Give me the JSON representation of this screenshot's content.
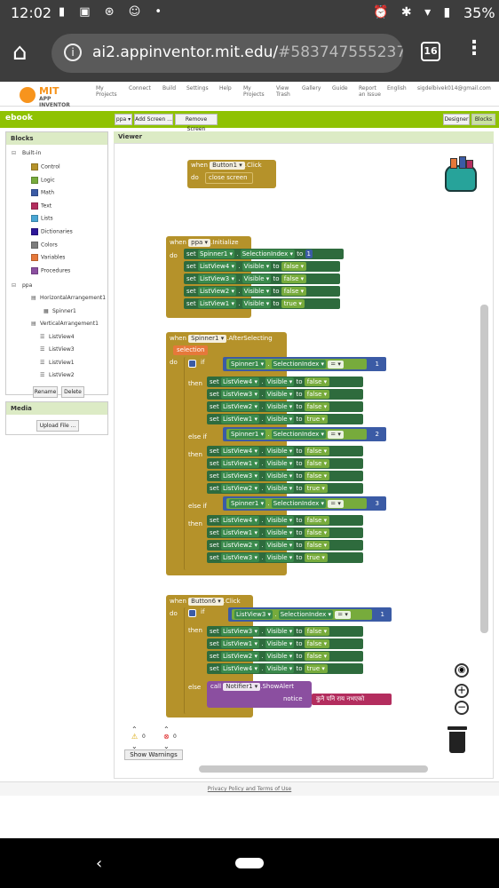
{
  "status": {
    "time": "12:02",
    "battery": "35%"
  },
  "browser": {
    "url_host": "ai2.appinventor.mit.edu/",
    "url_hash": "#583747555237",
    "tab_count": "16"
  },
  "appinv": {
    "logo_title": "MIT",
    "logo_sub": "APP INVENTOR",
    "nav": [
      "My Projects",
      "Connect",
      "Build",
      "Settings",
      "Help",
      "My Projects",
      "View Trash",
      "Gallery",
      "Guide",
      "Report an Issue",
      "English",
      "sigdelbivek014@gmail.com"
    ]
  },
  "screenbar": {
    "project": "ebook",
    "screen": "ppa ▾",
    "add": "Add Screen ...",
    "remove": "Remove Screen",
    "designer": "Designer",
    "blocks": "Blocks"
  },
  "blocks_panel": {
    "title": "Blocks",
    "builtin": "Built-in",
    "items": [
      {
        "label": "Control",
        "color": "#b5922a"
      },
      {
        "label": "Logic",
        "color": "#77ab3c"
      },
      {
        "label": "Math",
        "color": "#3b5ba5"
      },
      {
        "label": "Text",
        "color": "#b32d5e"
      },
      {
        "label": "Lists",
        "color": "#49a6d4"
      },
      {
        "label": "Dictionaries",
        "color": "#2d1799"
      },
      {
        "label": "Colors",
        "color": "#7d7d7d"
      },
      {
        "label": "Variables",
        "color": "#e6783a"
      },
      {
        "label": "Procedures",
        "color": "#8b4fa0"
      }
    ],
    "screen": "ppa",
    "components": [
      "HorizontalArrangement1",
      "Spinner1",
      "VerticalArrangement1",
      "ListView4",
      "ListView3",
      "ListView1",
      "ListView2"
    ],
    "rename": "Rename",
    "delete": "Delete"
  },
  "media": {
    "title": "Media",
    "upload": "Upload File ..."
  },
  "viewer": {
    "title": "Viewer"
  },
  "code": {
    "b1": {
      "when": "when",
      "comp": "Button1 ▾",
      "event": ".Click",
      "do": "do",
      "stmt": "close screen"
    },
    "init": {
      "when": "when",
      "comp": "ppa ▾",
      "event": ".Initialize",
      "do": "do",
      "sets": [
        {
          "comp": "Spinner1 ▾",
          "prop": "SelectionIndex ▾",
          "val": "1"
        },
        {
          "comp": "ListView4 ▾",
          "prop": "Visible ▾",
          "val": "false ▾"
        },
        {
          "comp": "ListView3 ▾",
          "prop": "Visible ▾",
          "val": "false ▾"
        },
        {
          "comp": "ListView2 ▾",
          "prop": "Visible ▾",
          "val": "false ▾"
        },
        {
          "comp": "ListView1 ▾",
          "prop": "Visible ▾",
          "val": "true ▾"
        }
      ]
    },
    "sel": {
      "when": "when",
      "comp": "Spinner1 ▾",
      "event": ".AfterSelecting",
      "param": "selection",
      "do": "do",
      "if": "if",
      "then": "then",
      "elseif": "else if",
      "conds": [
        {
          "comp": "Spinner1 ▾",
          "prop": "SelectionIndex ▾",
          "op": "= ▾",
          "num": "1"
        },
        {
          "comp": "Spinner1 ▾",
          "prop": "SelectionIndex ▾",
          "op": "= ▾",
          "num": "2"
        },
        {
          "comp": "Spinner1 ▾",
          "prop": "SelectionIndex ▾",
          "op": "= ▾",
          "num": "3"
        }
      ],
      "groups": [
        [
          {
            "comp": "ListView4 ▾",
            "val": "false ▾"
          },
          {
            "comp": "ListView3 ▾",
            "val": "false ▾"
          },
          {
            "comp": "ListView2 ▾",
            "val": "false ▾"
          },
          {
            "comp": "ListView1 ▾",
            "val": "true ▾"
          }
        ],
        [
          {
            "comp": "ListView4 ▾",
            "val": "false ▾"
          },
          {
            "comp": "ListView1 ▾",
            "val": "false ▾"
          },
          {
            "comp": "ListView3 ▾",
            "val": "false ▾"
          },
          {
            "comp": "ListView2 ▾",
            "val": "true ▾"
          }
        ],
        [
          {
            "comp": "ListView4 ▾",
            "val": "false ▾"
          },
          {
            "comp": "ListView1 ▾",
            "val": "false ▾"
          },
          {
            "comp": "ListView2 ▾",
            "val": "false ▾"
          },
          {
            "comp": "ListView3 ▾",
            "val": "true ▾"
          }
        ]
      ]
    },
    "b6": {
      "when": "when",
      "comp": "Button6 ▾",
      "event": ".Click",
      "do": "do",
      "if": "if",
      "then": "then",
      "else": "else",
      "cond": {
        "comp": "ListView3 ▾",
        "prop": "SelectionIndex ▾",
        "op": "= ▾",
        "num": "1"
      },
      "sets": [
        {
          "comp": "ListView3 ▾",
          "val": "false ▾"
        },
        {
          "comp": "ListView1 ▾",
          "val": "false ▾"
        },
        {
          "comp": "ListView2 ▾",
          "val": "false ▾"
        },
        {
          "comp": "ListView4 ▾",
          "val": "true ▾"
        }
      ],
      "call": "call",
      "notifier": "Notifier1 ▾",
      "method": ".ShowAlert",
      "notice": "notice",
      "text": "कुनै पनि राय नभएको"
    },
    "set": "set",
    "to": "to",
    "visible": "Visible ▾"
  },
  "warnings": {
    "warn_count": "0",
    "err_count": "0",
    "show": "Show Warnings"
  },
  "footer": "Privacy Policy and Terms of Use"
}
